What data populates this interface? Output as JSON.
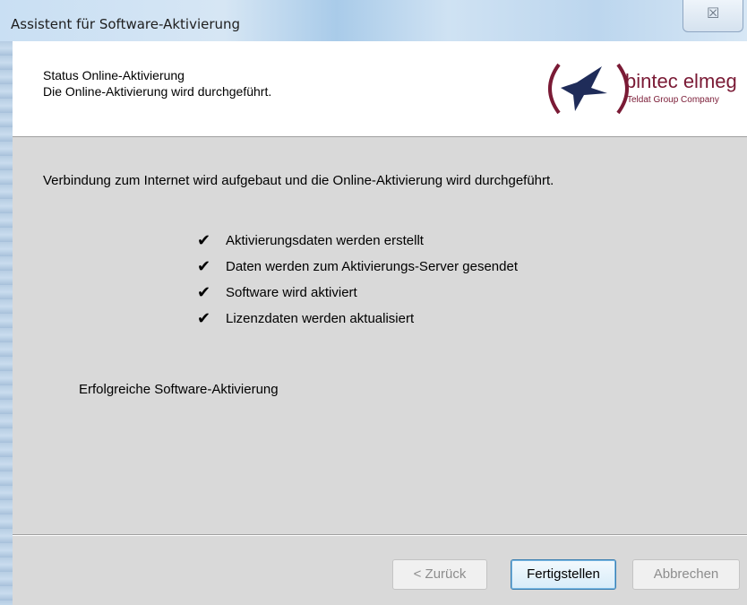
{
  "window": {
    "title": "Assistent für Software-Aktivierung",
    "close_icon": "close-icon",
    "close_glyph": "☒"
  },
  "header": {
    "title": "Status Online-Aktivierung",
    "subtitle": "Die Online-Aktivierung wird durchgeführt.",
    "logo": {
      "brand": "bintec elmeg",
      "tagline": "Teldat Group Company",
      "brand_color": "#7a1a35",
      "bird_color": "#1f2c59"
    }
  },
  "body": {
    "intro": "Verbindung zum Internet wird aufgebaut und die Online-Aktivierung wird durchgeführt.",
    "check_glyph": "✔",
    "steps": [
      {
        "label": "Aktivierungsdaten werden erstellt",
        "icon": "checkmark-icon"
      },
      {
        "label": "Daten werden zum Aktivierungs-Server gesendet",
        "icon": "checkmark-icon"
      },
      {
        "label": "Software wird aktiviert",
        "icon": "checkmark-icon"
      },
      {
        "label": "Lizenzdaten werden aktualisiert",
        "icon": "checkmark-icon"
      }
    ],
    "result": "Erfolgreiche Software-Aktivierung"
  },
  "buttons": {
    "back": "< Zurück",
    "finish": "Fertigstellen",
    "cancel": "Abbrechen"
  }
}
